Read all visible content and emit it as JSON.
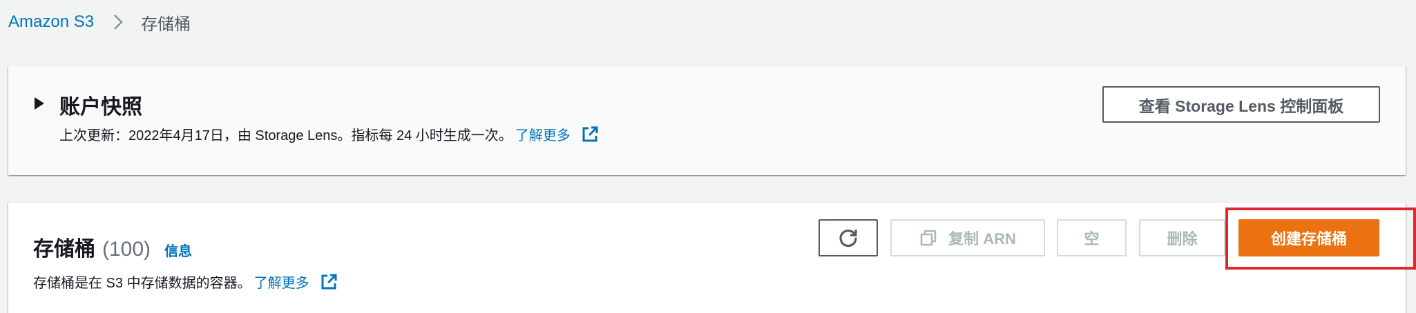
{
  "breadcrumb": {
    "root": "Amazon S3",
    "current": "存储桶",
    "separator_icon": "chevron-right-icon"
  },
  "snapshot": {
    "title": "账户快照",
    "toggle_icon": "caret-right-icon",
    "description": "上次更新：2022年4月17日，由 Storage Lens。指标每 24 小时生成一次。",
    "learn_more": "了解更多",
    "external_icon": "external-link-icon",
    "lens_button": "查看 Storage Lens 控制面板"
  },
  "buckets": {
    "title": "存储桶",
    "count": "(100)",
    "info": "信息",
    "description": "存储桶是在 S3 中存储数据的容器。",
    "learn_more": "了解更多",
    "external_icon": "external-link-icon",
    "actions": {
      "refresh_icon": "refresh-icon",
      "copy_icon": "copy-icon",
      "copy_arn": "复制 ARN",
      "empty": "空",
      "delete": "删除",
      "create": "创建存储桶"
    }
  },
  "colors": {
    "link": "#0073bb",
    "primary": "#ec7211",
    "highlight": "#e0262d",
    "disabled": "#aab7b8",
    "background": "#f2f3f3"
  }
}
